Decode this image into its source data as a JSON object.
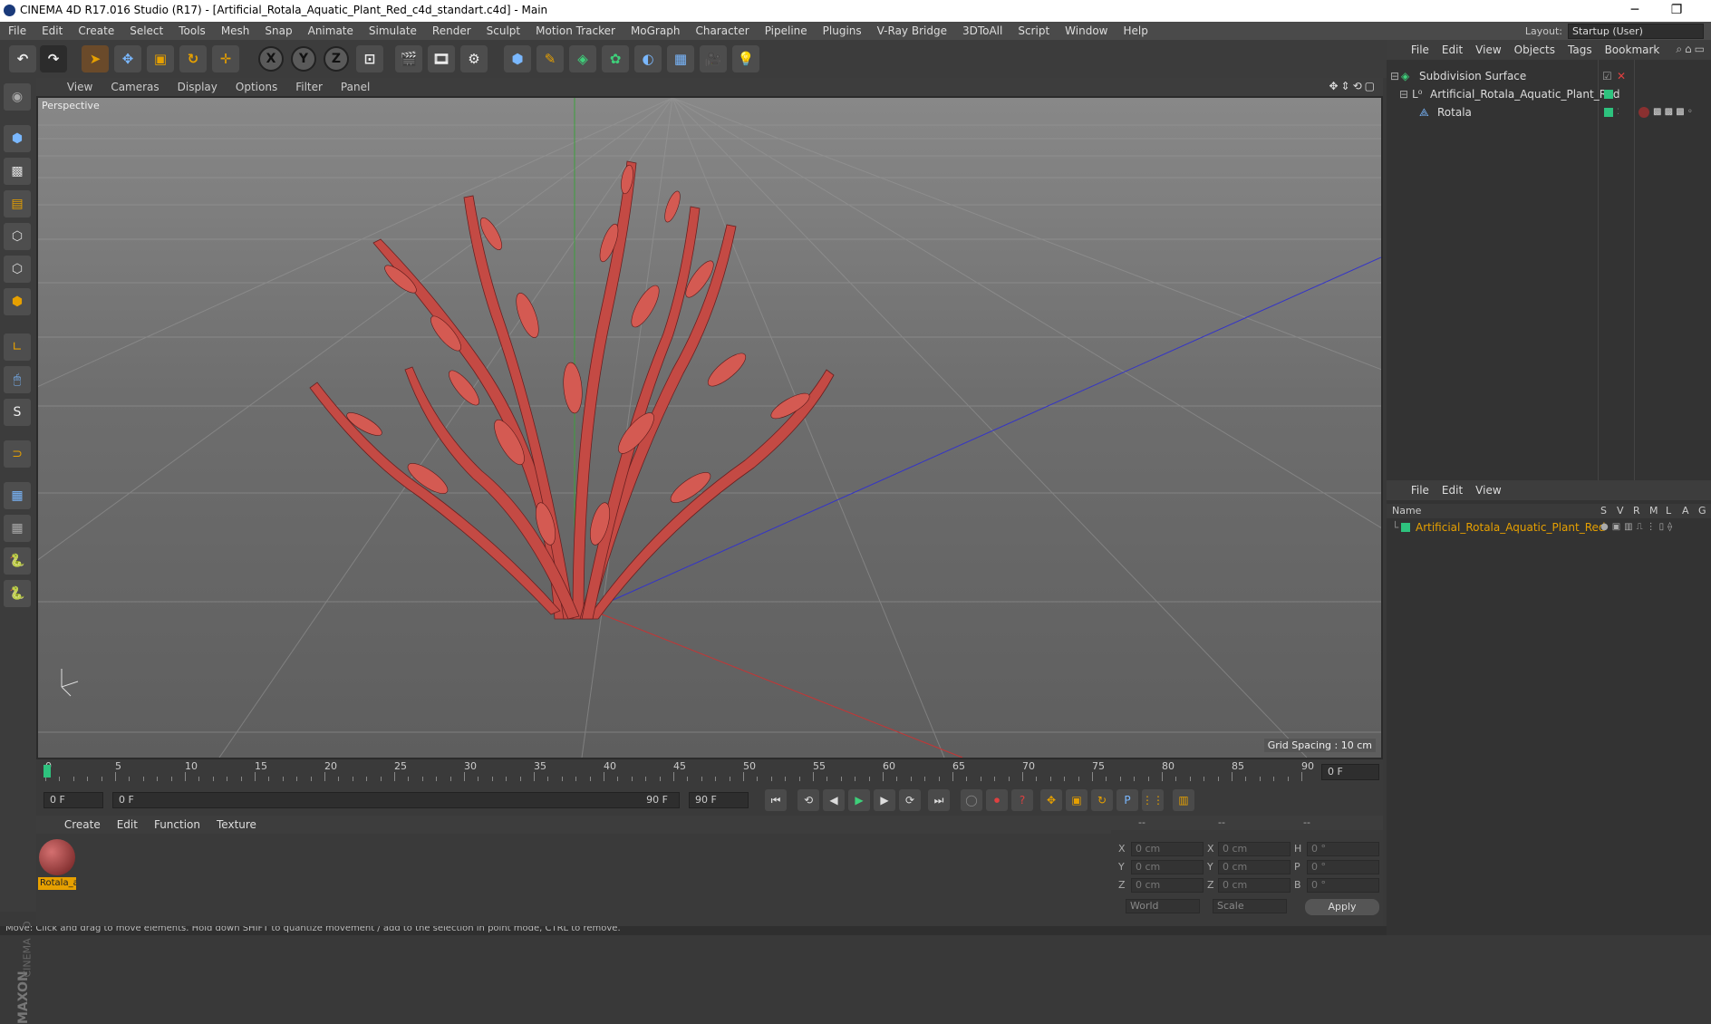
{
  "window": {
    "title": "CINEMA 4D R17.016 Studio (R17) - [Artificial_Rotala_Aquatic_Plant_Red_c4d_standart.c4d] - Main",
    "minimize": "─",
    "restore": "❐"
  },
  "menu": [
    "File",
    "Edit",
    "Create",
    "Select",
    "Tools",
    "Mesh",
    "Snap",
    "Animate",
    "Simulate",
    "Render",
    "Sculpt",
    "Motion Tracker",
    "MoGraph",
    "Character",
    "Pipeline",
    "Plugins",
    "V-Ray Bridge",
    "3DToAll",
    "Script",
    "Window",
    "Help"
  ],
  "layout": {
    "label": "Layout:",
    "value": "Startup (User)"
  },
  "viewport": {
    "menu": [
      "View",
      "Cameras",
      "Display",
      "Options",
      "Filter",
      "Panel"
    ],
    "camera": "Perspective",
    "grid_spacing": "Grid Spacing : 10 cm"
  },
  "timeline": {
    "ticks": [
      "0",
      "5",
      "10",
      "15",
      "20",
      "25",
      "30",
      "35",
      "40",
      "45",
      "50",
      "55",
      "60",
      "65",
      "70",
      "75",
      "80",
      "85",
      "90"
    ],
    "end_field": "0 F"
  },
  "playbar": {
    "current": "0 F",
    "range_start": "0 F",
    "range_end": "90 F",
    "end": "90 F"
  },
  "material_panel": {
    "menu": [
      "Create",
      "Edit",
      "Function",
      "Texture"
    ],
    "materials": [
      {
        "name": "Rotala_a"
      }
    ]
  },
  "coords": {
    "rows": [
      {
        "a": "X",
        "av": "0 cm",
        "b": "X",
        "bv": "0 cm",
        "c": "H",
        "cv": "0 °"
      },
      {
        "a": "Y",
        "av": "0 cm",
        "b": "Y",
        "bv": "0 cm",
        "c": "P",
        "cv": "0 °"
      },
      {
        "a": "Z",
        "av": "0 cm",
        "b": "Z",
        "bv": "0 cm",
        "c": "B",
        "cv": "0 °"
      }
    ],
    "space": "World",
    "mode": "Scale",
    "apply": "Apply",
    "header_dashes": [
      "--",
      "--",
      "--"
    ]
  },
  "object_manager": {
    "menu": [
      "File",
      "Edit",
      "View",
      "Objects",
      "Tags",
      "Bookmark"
    ],
    "items": [
      {
        "name": "Subdivision Surface"
      },
      {
        "name": "Artificial_Rotala_Aquatic_Plant_Red"
      },
      {
        "name": "Rotala"
      }
    ]
  },
  "attribute_manager": {
    "menu": [
      "File",
      "Edit",
      "View"
    ],
    "columns": {
      "name": "Name",
      "flags": [
        "S",
        "V",
        "R",
        "M",
        "L",
        "A",
        "G"
      ]
    },
    "items": [
      {
        "name": "Artificial_Rotala_Aquatic_Plant_Red"
      }
    ]
  },
  "status": "Move: Click and drag to move elements. Hold down SHIFT to quantize movement / add to the selection in point mode, CTRL to remove.",
  "brand": {
    "maxon": "MAXON",
    "cinema": "CINEMA 4D"
  }
}
